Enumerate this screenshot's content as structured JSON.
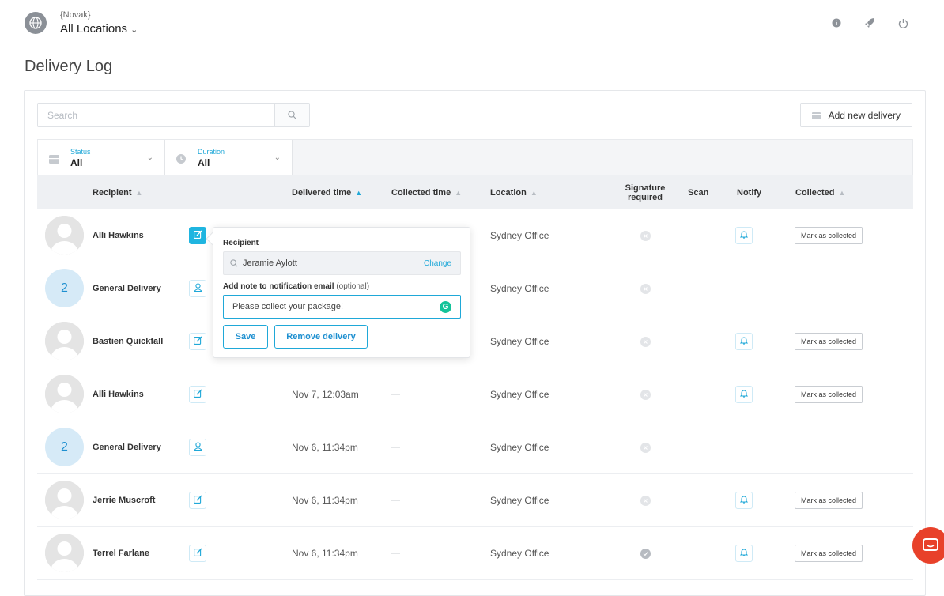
{
  "header": {
    "org_name": "{Novak}",
    "location": "All Locations",
    "icons": [
      "info-icon",
      "rocket-icon",
      "power-icon"
    ]
  },
  "page_title": "Delivery Log",
  "search": {
    "placeholder": "Search"
  },
  "add_delivery_label": "Add new delivery",
  "filters": [
    {
      "label": "Status",
      "value": "All"
    },
    {
      "label": "Duration",
      "value": "All"
    }
  ],
  "columns": {
    "recipient": "Recipient",
    "delivered_time": "Delivered time",
    "collected_time": "Collected time",
    "location": "Location",
    "signature_required_line1": "Signature",
    "signature_required_line2": "required",
    "scan": "Scan",
    "notify": "Notify",
    "collected": "Collected"
  },
  "rows": [
    {
      "recipient": "Alli Hawkins",
      "avatar": "photo",
      "delivered": "",
      "collected": "",
      "location": "Sydney Office",
      "signature_checked": false,
      "notify": true,
      "mark_label": "Mark as collected"
    },
    {
      "recipient": "General Delivery",
      "avatar": "2",
      "delivered": "",
      "collected": "",
      "location": "Sydney Office",
      "signature_checked": false,
      "notify": false,
      "mark_label": ""
    },
    {
      "recipient": "Bastien Quickfall",
      "avatar": "photo",
      "delivered": "",
      "collected": "",
      "location": "Sydney Office",
      "signature_checked": false,
      "notify": true,
      "mark_label": "Mark as collected"
    },
    {
      "recipient": "Alli Hawkins",
      "avatar": "photo",
      "delivered": "Nov 7, 12:03am",
      "collected": "—",
      "location": "Sydney Office",
      "signature_checked": false,
      "notify": true,
      "mark_label": "Mark as collected"
    },
    {
      "recipient": "General Delivery",
      "avatar": "2",
      "delivered": "Nov 6, 11:34pm",
      "collected": "—",
      "location": "Sydney Office",
      "signature_checked": false,
      "notify": false,
      "mark_label": ""
    },
    {
      "recipient": "Jerrie Muscroft",
      "avatar": "photo",
      "delivered": "Nov 6, 11:34pm",
      "collected": "—",
      "location": "Sydney Office",
      "signature_checked": false,
      "notify": true,
      "mark_label": "Mark as collected"
    },
    {
      "recipient": "Terrel Farlane",
      "avatar": "photo",
      "delivered": "Nov 6, 11:34pm",
      "collected": "—",
      "location": "Sydney Office",
      "signature_checked": true,
      "notify": true,
      "mark_label": "Mark as collected"
    }
  ],
  "popover": {
    "recipient_label": "Recipient",
    "recipient_value": "Jeramie Aylott",
    "change_label": "Change",
    "note_label": "Add note to notification email",
    "note_optional": "(optional)",
    "note_value": "Please collect your package!",
    "save_label": "Save",
    "remove_label": "Remove delivery"
  },
  "colors": {
    "accent": "#1fa8d8",
    "chat": "#e8412a"
  }
}
